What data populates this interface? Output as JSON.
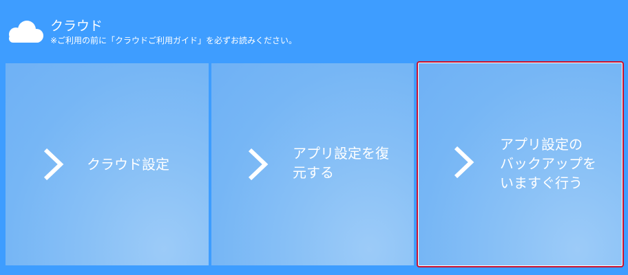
{
  "header": {
    "icon": "cloud-icon",
    "title": "クラウド",
    "subtitle": "※ご利用の前に「クラウドご利用ガイド」を必ずお読みください。"
  },
  "colors": {
    "background": "#3e9dff",
    "tile": "#76b6f5",
    "selected_border": "#c8102e",
    "text": "#ffffff"
  },
  "tiles": [
    {
      "icon": "chevron-right-icon",
      "lines": [
        "クラウド設定"
      ],
      "selected": false
    },
    {
      "icon": "chevron-right-icon",
      "lines": [
        "アプリ設定を復",
        "元する"
      ],
      "selected": false
    },
    {
      "icon": "chevron-right-icon",
      "lines": [
        "アプリ設定の",
        "バックアップを",
        "いますぐ行う"
      ],
      "selected": true
    }
  ]
}
